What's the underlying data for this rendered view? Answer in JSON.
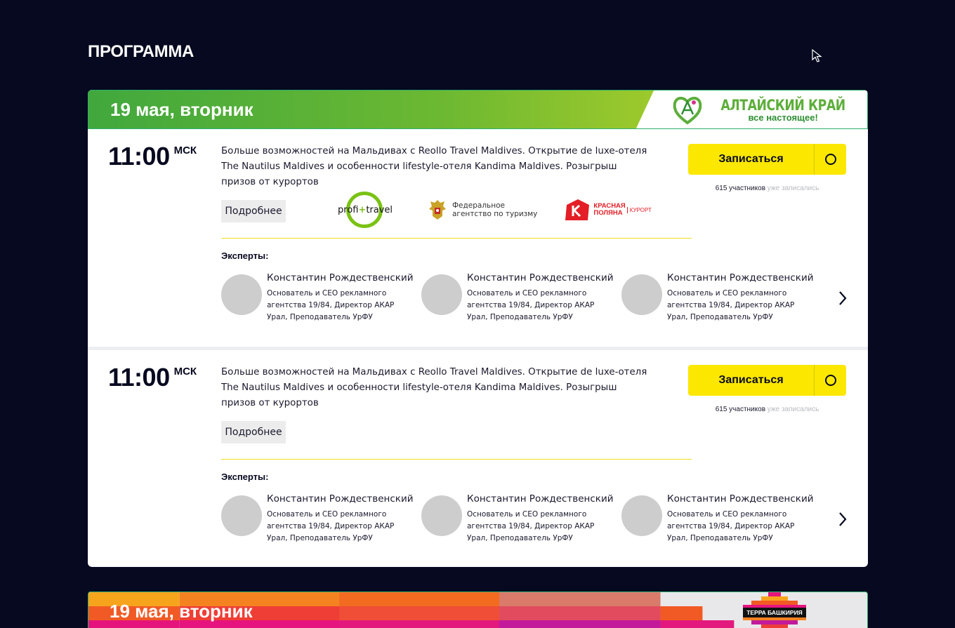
{
  "page": {
    "title": "ПРОГРАММА"
  },
  "day1": {
    "date": "19 мая, вторник",
    "sponsor": {
      "title": "АЛТАЙСКИЙ КРАЙ",
      "subtitle": "все настоящее!"
    },
    "sessions": [
      {
        "time": "11:00",
        "tz": "МСК",
        "description": "Больше возможностей на Мальдивах с Reollo Travel Maldives. Открытие de luxe-отеля The Nautilus Maldives и особенности lifestyle-отеля Kandima Maldives. Розыгрыш призов от курортов",
        "more_label": "Подробнее",
        "partners": {
          "profi_left": "profi",
          "profi_plus": "+",
          "profi_right": "travel",
          "fed": "Федеральное\nагентство по туризму",
          "kp_name": "КРАСНАЯ\nПОЛЯНА",
          "kp_tag": "КУРОРТ"
        },
        "signup_label": "Записаться",
        "participants": "615 участников",
        "participants_suffix": "уже записались",
        "experts_title": "Эксперты:",
        "experts": [
          {
            "name": "Константин Рождественский",
            "role": "Основатель и CEO рекламного агентства 19/84, Директор АКАР Урал, Преподаватель УрФУ"
          },
          {
            "name": "Константин Рождественский",
            "role": "Основатель и CEO рекламного агентства 19/84, Директор АКАР Урал, Преподаватель УрФУ"
          },
          {
            "name": "Константин Рождественский",
            "role": "Основатель и CEO рекламного агентства 19/84, Директор АКАР Урал, Преподаватель УрФУ"
          }
        ]
      },
      {
        "time": "11:00",
        "tz": "МСК",
        "description": "Больше возможностей на Мальдивах с Reollo Travel Maldives. Открытие de luxe-отеля The Nautilus Maldives и особенности lifestyle-отеля Kandima Maldives. Розыгрыш призов от курортов",
        "more_label": "Подробнее",
        "signup_label": "Записаться",
        "participants": "615 участников",
        "participants_suffix": "уже записались",
        "experts_title": "Эксперты:",
        "experts": [
          {
            "name": "Константин Рождественский",
            "role": "Основатель и CEO рекламного агентства 19/84, Директор АКАР Урал, Преподаватель УрФУ"
          },
          {
            "name": "Константин Рождественский",
            "role": "Основатель и CEO рекламного агентства 19/84, Директор АКАР Урал, Преподаватель УрФУ"
          },
          {
            "name": "Константин Рождественский",
            "role": "Основатель и CEO рекламного агентства 19/84, Директор АКАР Урал, Преподаватель УрФУ"
          }
        ]
      }
    ]
  },
  "day2": {
    "date": "19 мая, вторник",
    "sponsor": {
      "title": "ТЕРРА БАШКИРИЯ"
    }
  },
  "colors": {
    "background": "#06091f",
    "accent_yellow": "#fbe700",
    "banner_green": "#6cb832",
    "card": "#ffffff"
  },
  "icons": [
    "cursor-arrow-icon",
    "clock-circle-icon",
    "chevron-right-icon"
  ]
}
